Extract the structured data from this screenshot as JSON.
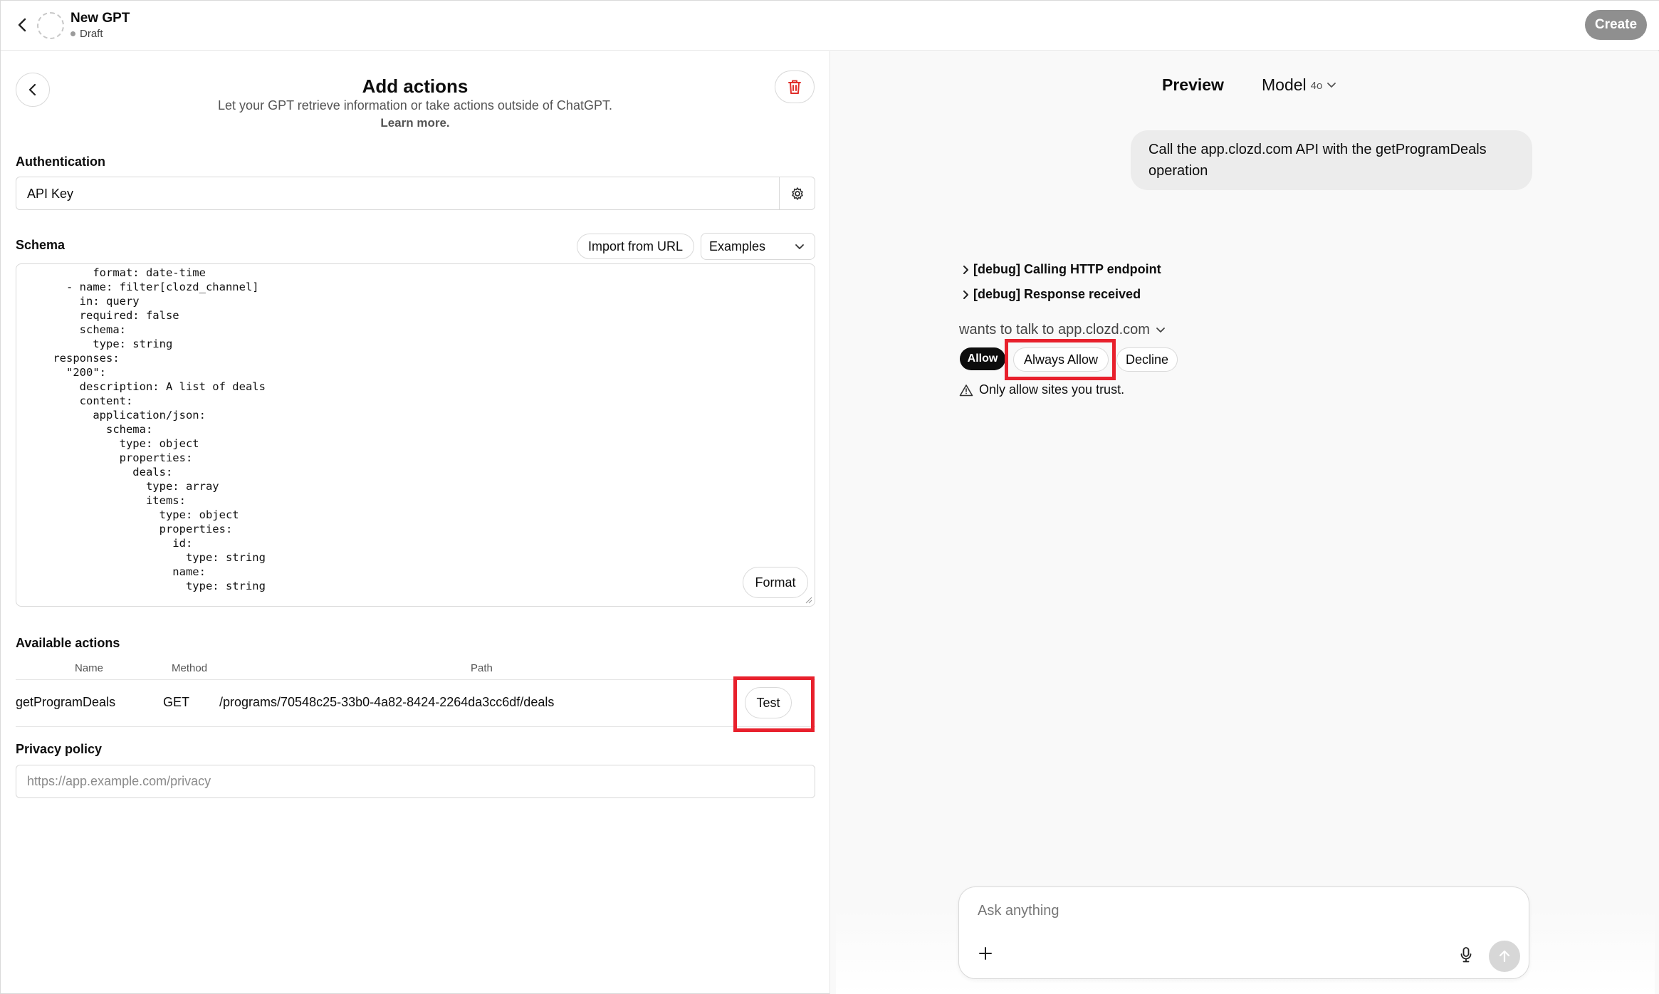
{
  "header": {
    "title": "New GPT",
    "status": "Draft",
    "create_label": "Create"
  },
  "editor": {
    "title": "Add actions",
    "subtitle": "Let your GPT retrieve information or take actions outside of ChatGPT.",
    "learn_more": "Learn more.",
    "authentication": {
      "label": "Authentication",
      "value": "API Key"
    },
    "schema": {
      "label": "Schema",
      "import_label": "Import from URL",
      "examples_label": "Examples",
      "format_label": "Format",
      "code": "          format: date-time\n      - name: filter[clozd_channel]\n        in: query\n        required: false\n        schema:\n          type: string\n    responses:\n      \"200\":\n        description: A list of deals\n        content:\n          application/json:\n            schema:\n              type: object\n              properties:\n                deals:\n                  type: array\n                  items:\n                    type: object\n                    properties:\n                      id:\n                        type: string\n                      name:\n                        type: string"
    },
    "actions": {
      "label": "Available actions",
      "columns": [
        "Name",
        "Method",
        "Path"
      ],
      "rows": [
        {
          "name": "getProgramDeals",
          "method": "GET",
          "path": "/programs/70548c25-33b0-4a82-8424-2264da3cc6df/deals",
          "test_label": "Test"
        }
      ]
    },
    "privacy": {
      "label": "Privacy policy",
      "placeholder": "https://app.example.com/privacy"
    }
  },
  "preview": {
    "title": "Preview",
    "model_label": "Model",
    "model_version": "4o",
    "user_message": "Call the app.clozd.com API with the getProgramDeals operation",
    "debug_lines": [
      "[debug] Calling HTTP endpoint",
      "[debug] Response received"
    ],
    "wants_text": "wants to talk to app.clozd.com",
    "allow_label": "Allow",
    "always_allow_label": "Always Allow",
    "decline_label": "Decline",
    "trust_warning": "Only allow sites you trust.",
    "composer_placeholder": "Ask anything"
  },
  "colors": {
    "highlight": "#e8202c",
    "create_bg": "#8f8f8f",
    "allow_bg": "#0d0d0d"
  }
}
